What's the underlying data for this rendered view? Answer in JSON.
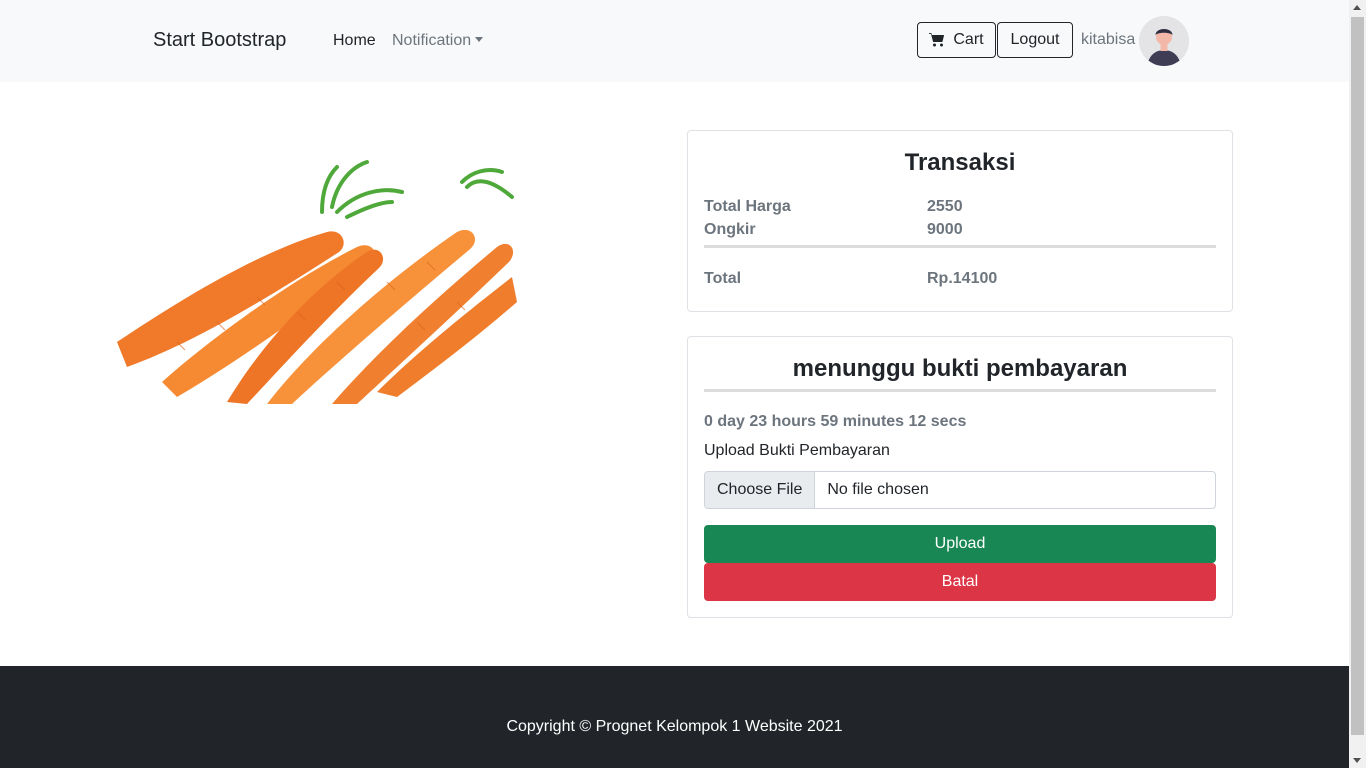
{
  "navbar": {
    "brand": "Start Bootstrap",
    "home": "Home",
    "notification": "Notification",
    "cart": "Cart",
    "logout": "Logout",
    "username": "kitabisa"
  },
  "product": {
    "image_icon": "carrot-photo"
  },
  "transaksi": {
    "title": "Transaksi",
    "total_harga_label": "Total Harga",
    "total_harga_value": "2550",
    "ongkir_label": "Ongkir",
    "ongkir_value": "9000",
    "total_label": "Total",
    "total_value": "Rp.14100"
  },
  "payment": {
    "status_title": "menunggu bukti pembayaran",
    "countdown": "0 day 23 hours 59 minutes 12 secs",
    "upload_label": "Upload Bukti Pembayaran",
    "file_button": "Choose File",
    "file_status": "No file chosen",
    "upload_button": "Upload",
    "cancel_button": "Batal"
  },
  "footer": {
    "copyright": "Copyright © Prognet Kelompok 1 Website 2021"
  },
  "colors": {
    "success": "#198754",
    "danger": "#dc3545",
    "footer_bg": "#212529",
    "navbar_bg": "#f8f9fa"
  }
}
